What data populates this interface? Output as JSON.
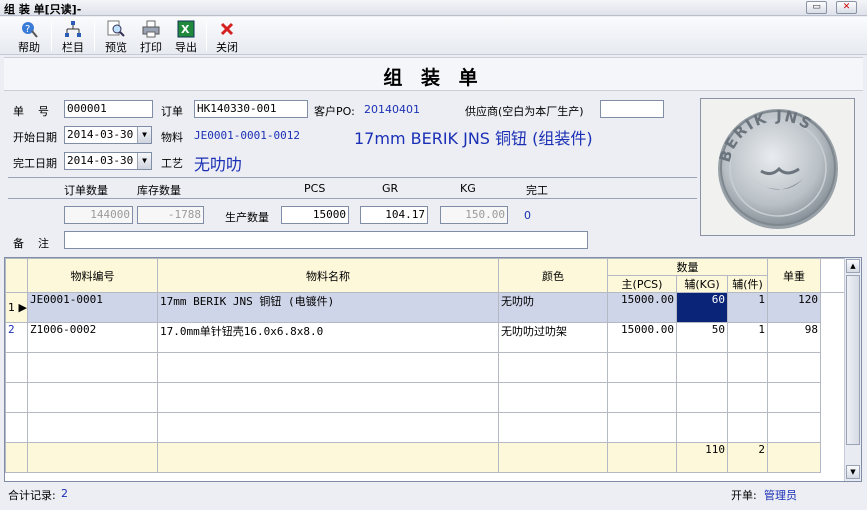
{
  "window": {
    "title": "组 装 单[只读]-"
  },
  "toolbar": [
    {
      "label": "帮助",
      "icon": "help-icon"
    },
    {
      "label": "栏目",
      "icon": "columns-icon"
    },
    {
      "label": "预览",
      "icon": "preview-icon"
    },
    {
      "label": "打印",
      "icon": "print-icon"
    },
    {
      "label": "导出",
      "icon": "excel-export-icon"
    },
    {
      "label": "关闭",
      "icon": "close-icon"
    }
  ],
  "form": {
    "title": "组 装 单",
    "order_no_label": "单    号",
    "order_no": "000001",
    "sales_order_label": "订单",
    "sales_order": "HK140330-001",
    "customer_po_label": "客户PO:",
    "customer_po": "20140401",
    "supplier_label": "供应商(空白为本厂生产)",
    "supplier": "",
    "start_date_label": "开始日期",
    "start_date": "2014-03-30",
    "material_label": "物料",
    "material_code": "JE0001-0001-0012",
    "material_desc": "17mm BERIK JNS 铜钮 (组装件)",
    "finish_date_label": "完工日期",
    "finish_date": "2014-03-30",
    "process_label": "工艺",
    "process": "无叻叻",
    "qty_headers": {
      "order_qty": "订单数量",
      "stock_qty": "库存数量",
      "pcs": "PCS",
      "gr": "GR",
      "kg": "KG",
      "done": "完工"
    },
    "order_qty": "144000",
    "stock_qty": "-1788",
    "production_qty_label": "生产数量",
    "prod_pcs": "15000",
    "prod_gr": "104.17",
    "prod_kg": "150.00",
    "done_value": "0",
    "remark_label": "备    注",
    "remark": ""
  },
  "photo": {
    "engraving": "BERIK JNS"
  },
  "grid": {
    "headers": {
      "code": "物料编号",
      "name": "物料名称",
      "color": "颜色",
      "qty": "数量",
      "unit_weight": "单重",
      "main": "主(PCS)",
      "aux_kg": "辅(KG)",
      "aux_pcs": "辅(件)"
    },
    "rows": [
      {
        "idx": "1",
        "code": "JE0001-0001",
        "name": "17mm BERIK JNS 铜钮 (电镀件)",
        "color": "无叻叻",
        "main": "15000.00",
        "aux_kg": "60",
        "aux_pcs": "1",
        "unit_weight": "120"
      },
      {
        "idx": "2",
        "code": "Z1006-0002",
        "name": "17.0mm单针钮壳16.0x6.8x8.0",
        "color": "无叻叻过叻架",
        "main": "15000.00",
        "aux_kg": "50",
        "aux_pcs": "1",
        "unit_weight": "98"
      }
    ],
    "totals": {
      "aux_kg": "110",
      "aux_pcs": "2"
    }
  },
  "status": {
    "records_label": "合计记录:",
    "records": "2",
    "creator_label": "开单:",
    "creator": "管理员"
  }
}
